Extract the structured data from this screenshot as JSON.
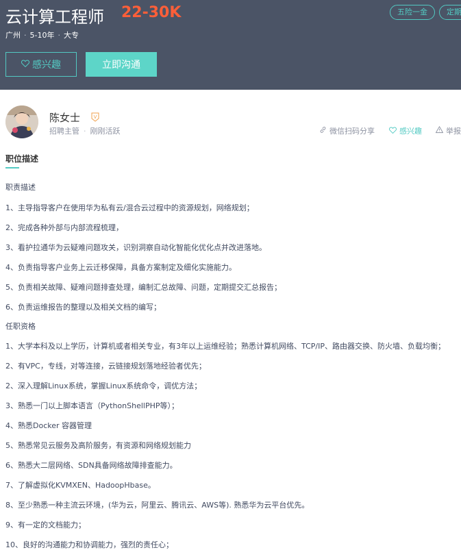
{
  "job": {
    "title": "云计算工程师",
    "salary": "22-30K",
    "location": "广州",
    "experience": "5-10年",
    "education": "大专",
    "tags": [
      "五险一金",
      "定期"
    ]
  },
  "buttons": {
    "interest_label": "感兴趣",
    "chat_label": "立即沟通"
  },
  "recruiter": {
    "name": "陈女士",
    "role": "招聘主管",
    "activity": "刚刚活跃",
    "badge": "V"
  },
  "actions": {
    "share": "微信扫码分享",
    "interest": "感兴趣",
    "report": "举报"
  },
  "description": {
    "section_title": "职位描述",
    "lines": [
      "职责描述",
      "1、主导指导客户在使用华为私有云/混合云过程中的资源规划，网络规划；",
      "2、完成各种外部与内部流程梳理，",
      "3、看护拉通华为云疑难问题攻关，识别洞察自动化智能化优化点并改进落地。",
      "4、负责指导客户业务上云迁移保障，具备方案制定及细化实施能力。",
      "5、负责相关故障、疑难问题排查处理，编制汇总故障、问题，定期提交汇总报告；",
      "6、负责运维报告的整理以及相关文档的编写；",
      "任职资格",
      "1、大学本科及以上学历，计算机或者相关专业，有3年以上运维经验；熟悉计算机网络、TCP/IP、路由器交换、防火墙、负载均衡；",
      "2、有VPC，专线，对等连接，云链接规划落地经验者优先；",
      "2、深入理解Linux系统，掌握Linux系统命令，调优方法；",
      "3、熟悉一门以上脚本语言（PythonShellPHP等）；",
      "4、熟悉Docker 容器管理",
      "5、熟悉常见云服务及高阶服务，有资源和网络规划能力",
      "6、熟悉大二层网络、SDN具备网络故障排查能力。",
      "7、了解虚拟化KVMXEN、HadoopHbase。",
      "8、至少熟悉一种主流云环境，(华为云，阿里云、腾讯云、AWS等). 熟悉华为云平台优先。",
      "9、有一定的文档能力；",
      "10、良好的沟通能力和协调能力，强烈的责任心；"
    ]
  },
  "colors": {
    "header_bg": "#4b5466",
    "accent": "#53cac3",
    "salary": "#fd5f39",
    "chat_button": "#5dd5c8"
  }
}
